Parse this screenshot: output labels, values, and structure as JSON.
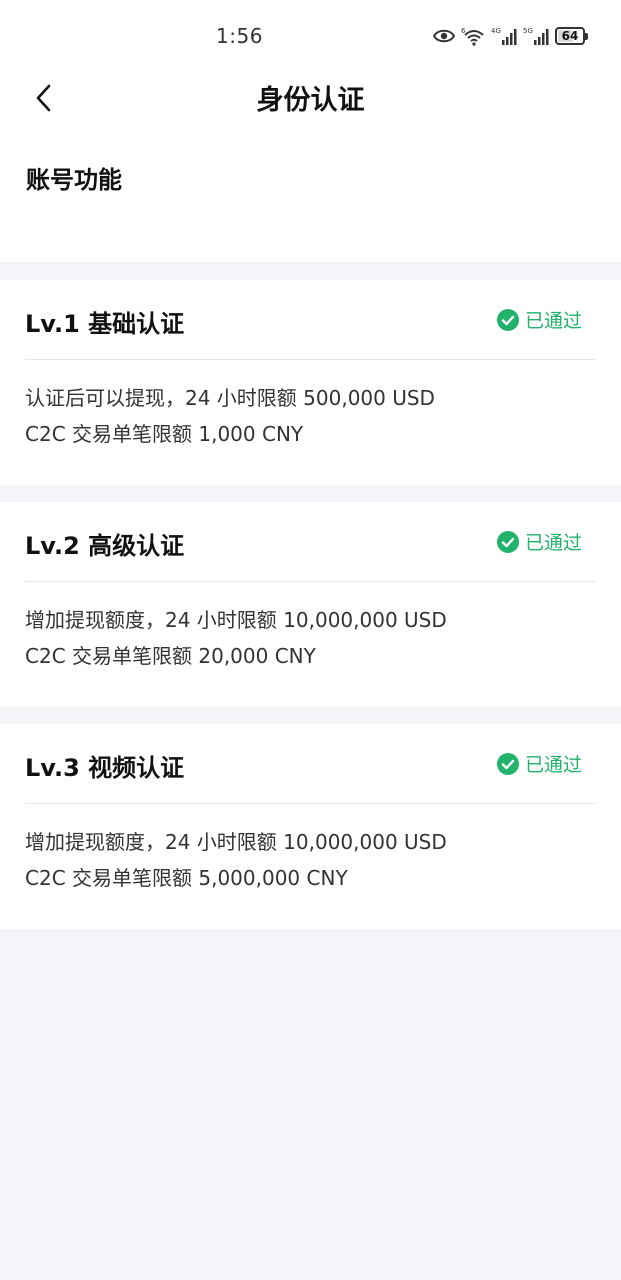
{
  "status_bar": {
    "time": "1:56",
    "battery": "64",
    "battery_level": 0.64,
    "icons": [
      "eye-icon",
      "wifi-icon",
      "signal-4g-icon",
      "signal-5g-icon",
      "battery-icon"
    ]
  },
  "header": {
    "title": "身份认证",
    "section_title": "账号功能"
  },
  "colors": {
    "accent_green": "#21b26b",
    "background": "#f3f5f9",
    "card": "#ffffff"
  },
  "levels": [
    {
      "title": "Lv.1 基础认证",
      "status": "已通过",
      "line1": "认证后可以提现，24 小时限额 500,000 USD",
      "line2": "C2C 交易单笔限额 1,000 CNY"
    },
    {
      "title": "Lv.2 高级认证",
      "status": "已通过",
      "line1": "增加提现额度，24 小时限额 10,000,000 USD",
      "line2": "C2C 交易单笔限额 20,000 CNY"
    },
    {
      "title": "Lv.3 视频认证",
      "status": "已通过",
      "line1": "增加提现额度，24 小时限额 10,000,000 USD",
      "line2": "C2C 交易单笔限额 5,000,000 CNY"
    }
  ]
}
